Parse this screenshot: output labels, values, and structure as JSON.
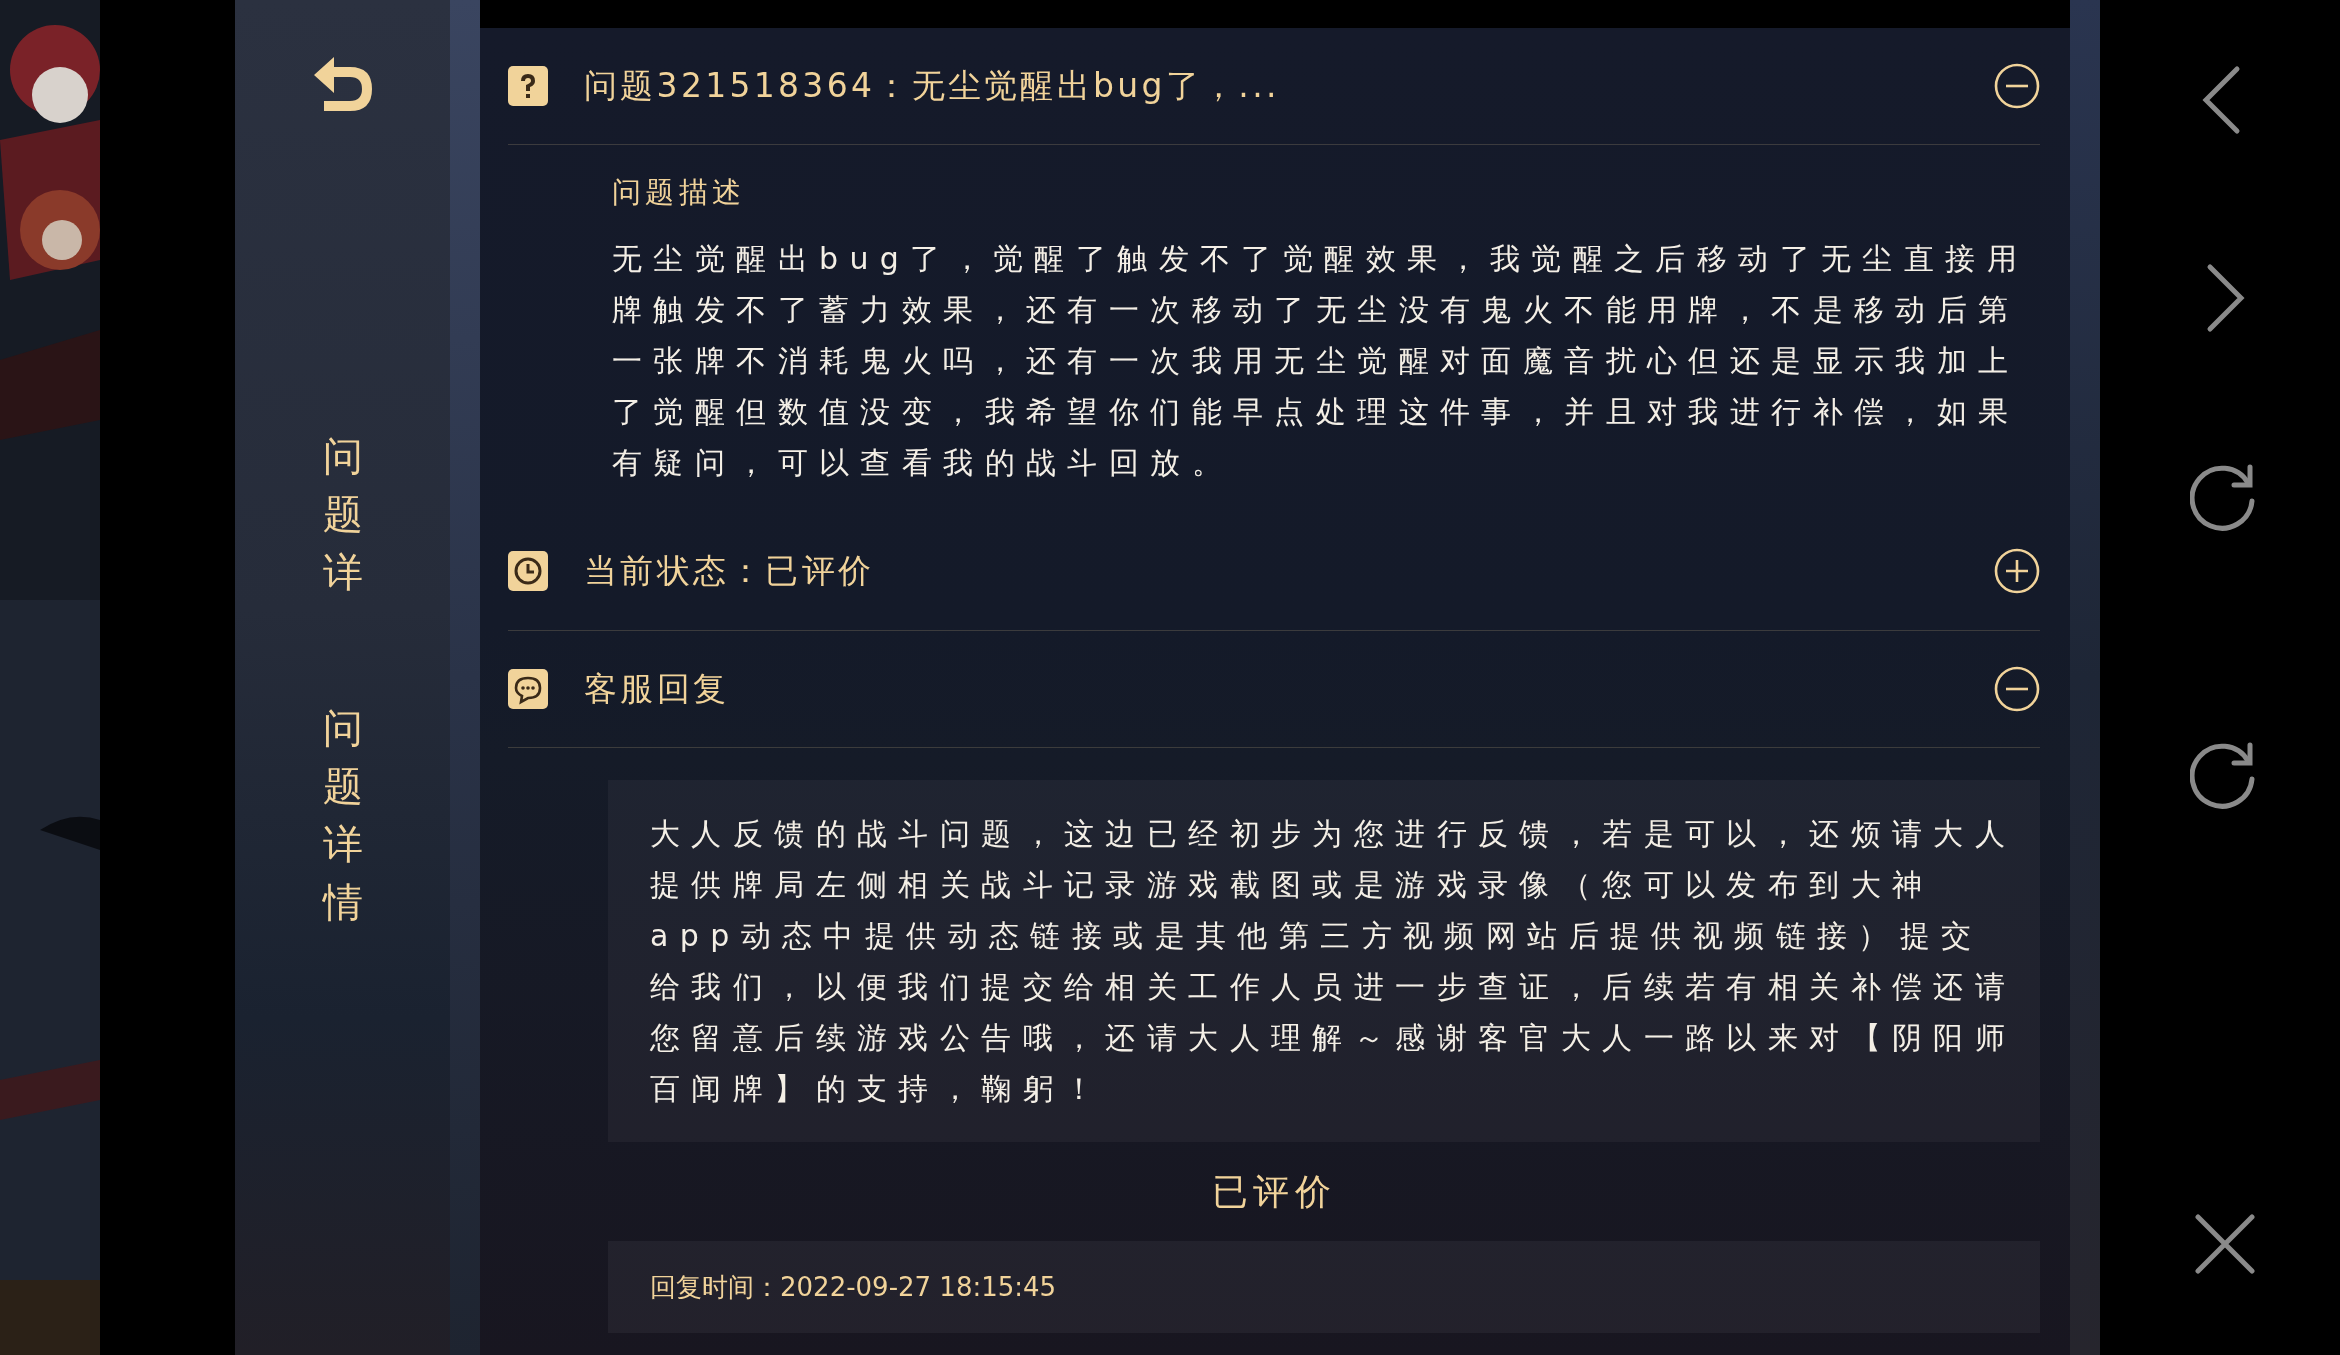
{
  "sidebar": {
    "titles": [
      "问题详",
      "问题详情"
    ]
  },
  "sections": [
    {
      "kind": "question",
      "title": "问题321518364：无尘觉醒出bug了，...",
      "expanded": true,
      "subtitle": "问题描述",
      "body": "无尘觉醒出bug了，觉醒了触发不了觉醒效果，我觉醒之后移动了无尘直接用牌触发不了蓄力效果，还有一次移动了无尘没有鬼火不能用牌，不是移动后第一张牌不消耗鬼火吗，还有一次我用无尘觉醒对面魔音扰心但还是显示我加上了觉醒但数值没变，我希望你们能早点处理这件事，并且对我进行补偿，如果有疑问，可以查看我的战斗回放。"
    },
    {
      "kind": "status",
      "title": "当前状态：已评价",
      "expanded": false
    },
    {
      "kind": "reply",
      "title": "客服回复",
      "expanded": true,
      "body": "大人反馈的战斗问题，这边已经初步为您进行反馈，若是可以，还烦请大人提供牌局左侧相关战斗记录游戏截图或是游戏录像（您可以发布到大神app动态中提供动态链接或是其他第三方视频网站后提供视频链接）提交给我们，以便我们提交给相关工作人员进一步查证，后续若有相关补偿还请您留意后续游戏公告哦，还请大人理解～感谢客官大人一路以来对【阴阳师百闻牌】的支持，鞠躬！"
    }
  ],
  "rating_label": "已评价",
  "reply_time": "回复时间：2022-09-27 18:15:45"
}
